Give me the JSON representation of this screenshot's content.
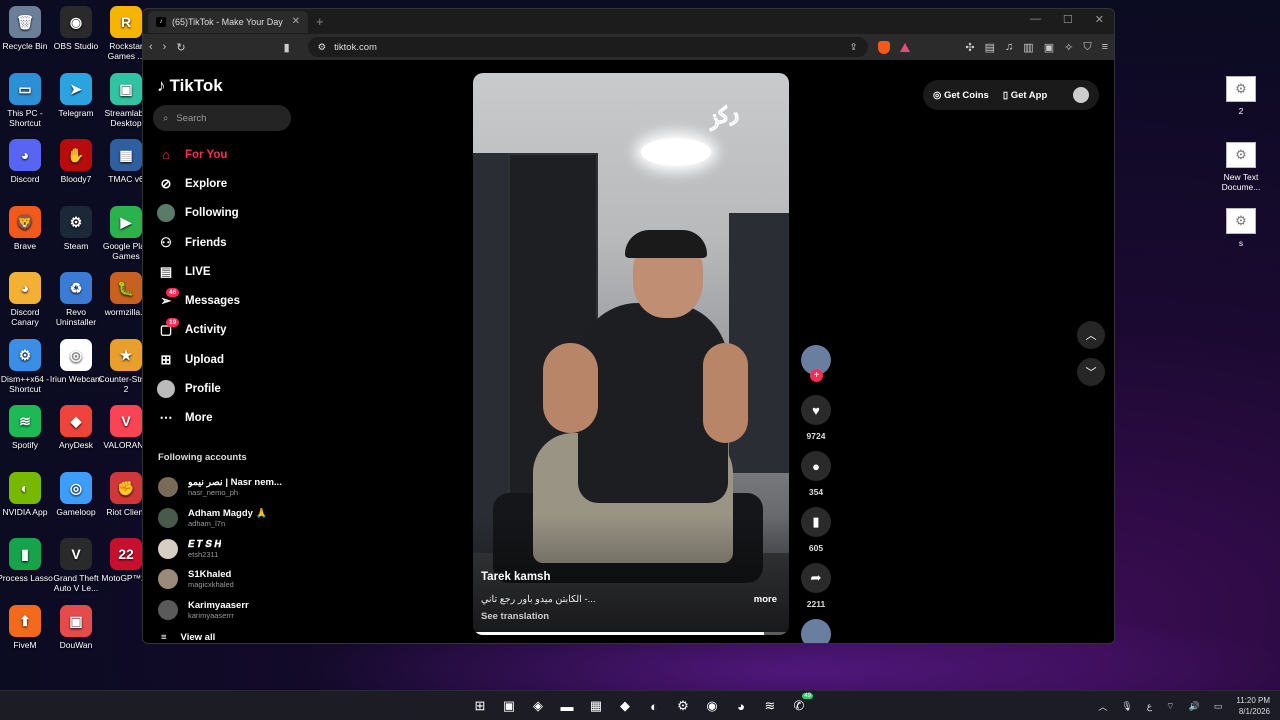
{
  "desktop": {
    "left_icons": [
      {
        "label": "Recycle Bin",
        "icon": "recycle-bin-icon",
        "color": "#6b7f99",
        "glyph": "🗑"
      },
      {
        "label": "OBS Studio",
        "icon": "obs-icon",
        "color": "#2a2a2a",
        "glyph": "◉"
      },
      {
        "label": "Rockstar Games ...",
        "icon": "rockstar-icon",
        "color": "#f5b400",
        "glyph": "R"
      },
      {
        "label": "This PC - Shortcut",
        "icon": "pc-icon",
        "color": "#2d8fd5",
        "glyph": "▭"
      },
      {
        "label": "Telegram",
        "icon": "telegram-icon",
        "color": "#2aa3df",
        "glyph": "➤"
      },
      {
        "label": "Streamlabs Desktop",
        "icon": "streamlabs-icon",
        "color": "#31c3a2",
        "glyph": "▣"
      },
      {
        "label": "Discord",
        "icon": "discord-icon",
        "color": "#5865f2",
        "glyph": "◕"
      },
      {
        "label": "Bloody7",
        "icon": "bloody-icon",
        "color": "#b80c0c",
        "glyph": "✋"
      },
      {
        "label": "TMAC v6",
        "icon": "tmac-icon",
        "color": "#2f5f9e",
        "glyph": "▦"
      },
      {
        "label": "Brave",
        "icon": "brave-icon",
        "color": "#f25a1c",
        "glyph": "🦁"
      },
      {
        "label": "Steam",
        "icon": "steam-icon",
        "color": "#1b2838",
        "glyph": "⚙"
      },
      {
        "label": "Google Play Games",
        "icon": "google-play-icon",
        "color": "#2bb24c",
        "glyph": "▶"
      },
      {
        "label": "Discord Canary",
        "icon": "discord-canary-icon",
        "color": "#f2b035",
        "glyph": "◕"
      },
      {
        "label": "Revo Uninstaller",
        "icon": "revo-icon",
        "color": "#3b7bd4",
        "glyph": "♻"
      },
      {
        "label": "wormzilla...",
        "icon": "wormzilla-icon",
        "color": "#c8611f",
        "glyph": "🐛"
      },
      {
        "label": "Dism++x64 - Shortcut",
        "icon": "dism-icon",
        "color": "#3a8ee6",
        "glyph": "⚙"
      },
      {
        "label": "Iriun Webcam",
        "icon": "webcam-icon",
        "color": "#ffffff",
        "glyph": "◎"
      },
      {
        "label": "Counter-Strike 2",
        "icon": "cs2-icon",
        "color": "#e89f2c",
        "glyph": "★"
      },
      {
        "label": "Spotify",
        "icon": "spotify-icon",
        "color": "#1db954",
        "glyph": "≋"
      },
      {
        "label": "AnyDesk",
        "icon": "anydesk-icon",
        "color": "#ef443b",
        "glyph": "◆"
      },
      {
        "label": "VALORANT",
        "icon": "valorant-icon",
        "color": "#fa4454",
        "glyph": "V"
      },
      {
        "label": "NVIDIA App",
        "icon": "nvidia-icon",
        "color": "#76b900",
        "glyph": "◐"
      },
      {
        "label": "Gameloop",
        "icon": "gameloop-icon",
        "color": "#3d9dfb",
        "glyph": "◎"
      },
      {
        "label": "Riot Client",
        "icon": "riot-icon",
        "color": "#d13639",
        "glyph": "✊"
      },
      {
        "label": "Process Lasso",
        "icon": "process-lasso-icon",
        "color": "#17a34a",
        "glyph": "▮"
      },
      {
        "label": "Grand Theft Auto V Le...",
        "icon": "gta-icon",
        "color": "#2a2a2a",
        "glyph": "V"
      },
      {
        "label": "MotoGP™22",
        "icon": "motogp-icon",
        "color": "#c8102e",
        "glyph": "22"
      },
      {
        "label": "FiveM",
        "icon": "fivem-icon",
        "color": "#f26b1d",
        "glyph": "⬆"
      },
      {
        "label": "DouWan",
        "icon": "douwan-icon",
        "color": "#e54b4b",
        "glyph": "▣"
      }
    ],
    "right_icons": [
      {
        "label": "2"
      },
      {
        "label": "New Text Docume..."
      },
      {
        "label": "s"
      }
    ]
  },
  "browser": {
    "tab_title": "(65)TikTok - Make Your Day",
    "url": "tiktok.com"
  },
  "tiktok": {
    "logo": "TikTok",
    "search_placeholder": "Search",
    "nav": [
      {
        "label": "For You",
        "icon": "home-icon",
        "glyph": "⌂",
        "active": true,
        "badge": ""
      },
      {
        "label": "Explore",
        "icon": "compass-icon",
        "glyph": "⊘",
        "active": false,
        "badge": ""
      },
      {
        "label": "Following",
        "icon": "following-avatar-icon",
        "glyph": "",
        "active": false,
        "badge": ""
      },
      {
        "label": "Friends",
        "icon": "friends-icon",
        "glyph": "⚇",
        "active": false,
        "badge": ""
      },
      {
        "label": "LIVE",
        "icon": "live-icon",
        "glyph": "▤",
        "active": false,
        "badge": ""
      },
      {
        "label": "Messages",
        "icon": "messages-icon",
        "glyph": "➢",
        "active": false,
        "badge": "46"
      },
      {
        "label": "Activity",
        "icon": "activity-icon",
        "glyph": "▢",
        "active": false,
        "badge": "19"
      },
      {
        "label": "Upload",
        "icon": "upload-icon",
        "glyph": "⊞",
        "active": false,
        "badge": ""
      },
      {
        "label": "Profile",
        "icon": "profile-icon",
        "glyph": "●",
        "active": false,
        "badge": ""
      },
      {
        "label": "More",
        "icon": "more-icon",
        "glyph": "⋯",
        "active": false,
        "badge": ""
      }
    ],
    "following_title": "Following accounts",
    "following": [
      {
        "name": "نصر نيمو | Nasr nem...",
        "user": "nasr_nemo_ph"
      },
      {
        "name": "Adham Magdy 🙏",
        "user": "adham_l7n"
      },
      {
        "name": "𝑬 𝑻 𝑺 𝑯",
        "user": "etsh2311"
      },
      {
        "name": "S1Khaled",
        "user": "magicxkhaled"
      },
      {
        "name": "Karimyaaserr",
        "user": "karimyaaserrr"
      }
    ],
    "view_all": "View all",
    "video": {
      "author": "Tarek kamsh",
      "caption": "الكابتن ميدو باور رجع تاني -...",
      "more": "more",
      "see_translation": "See translation",
      "sticker": "ركز",
      "progress": 0.92
    },
    "actions": {
      "likes": "9724",
      "comments": "354",
      "saves": "605",
      "shares": "2211"
    },
    "get_coins": "Get Coins",
    "get_app": "Get App"
  },
  "taskbar": {
    "apps": [
      {
        "icon": "windows-start-icon",
        "glyph": "⊞"
      },
      {
        "icon": "task-view-icon",
        "glyph": "▣"
      },
      {
        "icon": "copilot-icon",
        "glyph": "◈"
      },
      {
        "icon": "file-explorer-icon",
        "glyph": "▬"
      },
      {
        "icon": "store-icon",
        "glyph": "▦"
      },
      {
        "icon": "brave-taskbar-icon",
        "glyph": "◆"
      },
      {
        "icon": "edge-icon",
        "glyph": "◐"
      },
      {
        "icon": "steam-taskbar-icon",
        "glyph": "⚙"
      },
      {
        "icon": "obs-taskbar-icon",
        "glyph": "◉"
      },
      {
        "icon": "discord-taskbar-icon",
        "glyph": "◕"
      },
      {
        "icon": "spotify-taskbar-icon",
        "glyph": "≋"
      },
      {
        "icon": "whatsapp-taskbar-icon",
        "glyph": "✆"
      }
    ],
    "whatsapp_badge": "49",
    "lang": "ع",
    "time": "11:20 PM",
    "date": "8/1/2026"
  }
}
